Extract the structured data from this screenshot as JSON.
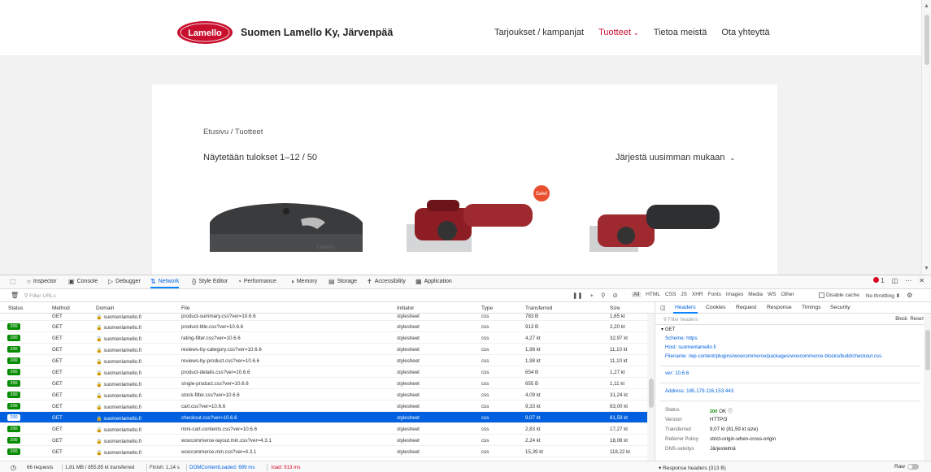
{
  "site": {
    "logo_text": "Lamello",
    "brand": "Suomen Lamello Ky, Järvenpää",
    "nav": [
      {
        "label": "Tarjoukset / kampanjat",
        "active": false
      },
      {
        "label": "Tuotteet",
        "active": true,
        "dropdown": true
      },
      {
        "label": "Tietoa meistä",
        "active": false
      },
      {
        "label": "Ota yhteyttä",
        "active": false
      }
    ],
    "breadcrumb": "Etusivu / Tuotteet",
    "results_text": "Näytetään tulokset 1–12 / 50",
    "sort_label": "Järjestä uusimman mukaan",
    "sale_badge": "Sale!",
    "product_label": "Lamello",
    "colors": {
      "brand_red": "#c8102e",
      "sale": "#e8502f"
    }
  },
  "devtools": {
    "tabs": [
      {
        "icon": "inspector-icon",
        "label": "Inspector"
      },
      {
        "icon": "console-icon",
        "label": "Console"
      },
      {
        "icon": "debugger-icon",
        "label": "Debugger"
      },
      {
        "icon": "network-icon",
        "label": "Network",
        "active": true
      },
      {
        "icon": "style-editor-icon",
        "label": "Style Editor"
      },
      {
        "icon": "performance-icon",
        "label": "Performance"
      },
      {
        "icon": "memory-icon",
        "label": "Memory"
      },
      {
        "icon": "storage-icon",
        "label": "Storage"
      },
      {
        "icon": "accessibility-icon",
        "label": "Accessibility"
      },
      {
        "icon": "application-icon",
        "label": "Application"
      }
    ],
    "error_count": "1",
    "filter_placeholder": "Filter URLs",
    "type_filters": [
      "All",
      "HTML",
      "CSS",
      "JS",
      "XHR",
      "Fonts",
      "Images",
      "Media",
      "WS",
      "Other"
    ],
    "disable_cache_label": "Disable cache",
    "throttling_label": "No throttling ⬍",
    "columns": [
      "Status",
      "Method",
      "Domain",
      "File",
      "Initiator",
      "Type",
      "Transferred",
      "Size"
    ],
    "partial_row": {
      "method": "GET",
      "domain": "suomenlamello.fi",
      "file": "product-summary.css?ver=10.6.6",
      "initiator": "stylesheet",
      "type": "css",
      "transferred": "783 B",
      "size": "1,65 kt"
    },
    "rows": [
      {
        "status": "200",
        "method": "GET",
        "domain": "suomenlamello.fi",
        "file": "product-title.css?ver=10.6.6",
        "initiator": "stylesheet",
        "type": "css",
        "transferred": "913 B",
        "size": "2,20 kt"
      },
      {
        "status": "200",
        "method": "GET",
        "domain": "suomenlamello.fi",
        "file": "rating-filter.css?ver=10.6.6",
        "initiator": "stylesheet",
        "type": "css",
        "transferred": "4,27 kt",
        "size": "32,97 kt"
      },
      {
        "status": "200",
        "method": "GET",
        "domain": "suomenlamello.fi",
        "file": "reviews-by-category.css?ver=10.6.6",
        "initiator": "stylesheet",
        "type": "css",
        "transferred": "1,98 kt",
        "size": "11,10 kt"
      },
      {
        "status": "200",
        "method": "GET",
        "domain": "suomenlamello.fi",
        "file": "reviews-by-product.css?ver=10.6.6",
        "initiator": "stylesheet",
        "type": "css",
        "transferred": "1,98 kt",
        "size": "11,10 kt"
      },
      {
        "status": "200",
        "method": "GET",
        "domain": "suomenlamello.fi",
        "file": "product-details.css?ver=10.6.6",
        "initiator": "stylesheet",
        "type": "css",
        "transferred": "654 B",
        "size": "1,27 kt"
      },
      {
        "status": "200",
        "method": "GET",
        "domain": "suomenlamello.fi",
        "file": "single-product.css?ver=10.6.6",
        "initiator": "stylesheet",
        "type": "css",
        "transferred": "655 B",
        "size": "1,11 kt"
      },
      {
        "status": "200",
        "method": "GET",
        "domain": "suomenlamello.fi",
        "file": "stock-filter.css?ver=10.6.6",
        "initiator": "stylesheet",
        "type": "css",
        "transferred": "4,09 kt",
        "size": "31,24 kt"
      },
      {
        "status": "200",
        "method": "GET",
        "domain": "suomenlamello.fi",
        "file": "cart.css?ver=10.6.6",
        "initiator": "stylesheet",
        "type": "css",
        "transferred": "9,33 kt",
        "size": "83,00 kt"
      },
      {
        "status": "200",
        "method": "GET",
        "domain": "suomenlamello.fi",
        "file": "checkout.css?ver=10.6.6",
        "initiator": "stylesheet",
        "type": "css",
        "transferred": "9,07 kt",
        "size": "81,59 kt",
        "selected": true
      },
      {
        "status": "200",
        "method": "GET",
        "domain": "suomenlamello.fi",
        "file": "mini-cart-contents.css?ver=10.6.6",
        "initiator": "stylesheet",
        "type": "css",
        "transferred": "2,83 kt",
        "size": "17,27 kt"
      },
      {
        "status": "200",
        "method": "GET",
        "domain": "suomenlamello.fi",
        "file": "woocommerce-layout.min.css?ver=4.3.1",
        "initiator": "stylesheet",
        "type": "css",
        "transferred": "2,24 kt",
        "size": "18,08 kt"
      },
      {
        "status": "200",
        "method": "GET",
        "domain": "suomenlamello.fi",
        "file": "woocommerce.min.css?ver=4.3.1",
        "initiator": "stylesheet",
        "type": "css",
        "transferred": "15,39 kt",
        "size": "118,22 kt"
      }
    ],
    "details": {
      "tabs": [
        "Headers",
        "Cookies",
        "Request",
        "Response",
        "Timings",
        "Security"
      ],
      "filter_placeholder": "Filter headers",
      "block_label": "Block",
      "resend_label": "Resend",
      "method": "GET",
      "scheme_label": "Scheme:",
      "scheme": "https",
      "host_label": "Host:",
      "host": "suomenlamello.fi",
      "filename_label": "Filename:",
      "filename": "/wp-content/plugins/woocommerce/packages/woocommerce-blocks/build/checkout.css",
      "ver_label": "ver:",
      "ver": "10.6.6",
      "address_label": "Address:",
      "address": "185.179.116.153:443",
      "status_label": "Status",
      "status_code": "200",
      "status_text": "OK",
      "version_label": "Version",
      "version": "HTTP/3",
      "transferred_label": "Transferred",
      "transferred": "9,07 kt (81,59 kt size)",
      "referrer_label": "Referrer Policy",
      "referrer": "strict-origin-when-cross-origin",
      "dns_label": "DNS-selvitys",
      "dns": "Järjestelmä",
      "response_headers": "Response headers (313 B)",
      "raw_label": "Raw"
    },
    "status_bar": {
      "requests": "66 requests",
      "transferred": "1,81 MB / 855,85 kt transferred",
      "finish": "Finish: 1,14 s",
      "dcl": "DOMContentLoaded: 699 ms",
      "load": "load: 913 ms"
    }
  }
}
